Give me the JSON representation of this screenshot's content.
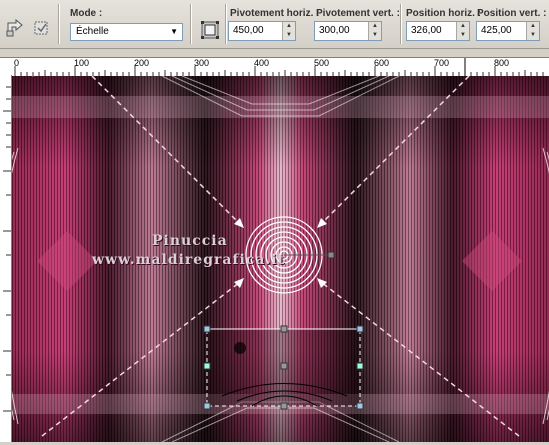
{
  "toolbar": {
    "mode": {
      "label": "Mode :",
      "value": "Échelle"
    },
    "pivot_h": {
      "label": "Pivotement horiz. :",
      "value": "450,00"
    },
    "pivot_v": {
      "label": "Pivotement vert. :",
      "value": "300,00"
    },
    "pos_h": {
      "label": "Position horiz. :",
      "value": "326,00"
    },
    "pos_v": {
      "label": "Position vert. :",
      "value": "425,00"
    }
  },
  "ruler": {
    "ticks": [
      "0",
      "100",
      "200",
      "300",
      "400",
      "500",
      "600",
      "700",
      "800"
    ]
  },
  "watermark": {
    "line1": "Pinuccia",
    "line2": "www.maldiregrafica.it"
  },
  "icons": [
    "reset-icon",
    "apply-icon",
    "pick-tool-icon"
  ]
}
